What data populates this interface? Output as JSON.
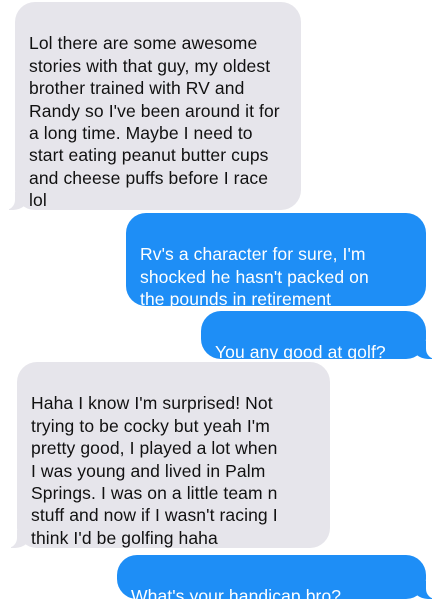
{
  "conversation": {
    "messages": [
      {
        "direction": "incoming",
        "text": "Lol there are some awesome\nstories with that guy, my oldest\nbrother trained with RV and\nRandy so I've been around it for\na long time. Maybe I need to\nstart eating peanut butter cups\nand cheese puffs before I race\nlol"
      },
      {
        "direction": "outgoing",
        "text": "Rv's a character for sure, I'm\nshocked he hasn't packed on\nthe pounds in retirement"
      },
      {
        "direction": "outgoing",
        "text": "You any good at golf?"
      },
      {
        "direction": "incoming",
        "text": "Haha I know I'm surprised! Not\ntrying to be cocky but yeah I'm\npretty good, I played a lot when\nI was young and lived in Palm\nSprings. I was on a little team n\nstuff and now if I wasn't racing I\nthink I'd be golfing haha"
      },
      {
        "direction": "outgoing",
        "text": "What's your handicap bro?",
        "emoji": "golfer-emoji"
      }
    ]
  },
  "colors": {
    "incoming_bubble": "#e6e5eb",
    "outgoing_bubble": "#1e8ef6",
    "incoming_text": "#111111",
    "outgoing_text": "#ffffff",
    "background": "#ffffff"
  }
}
